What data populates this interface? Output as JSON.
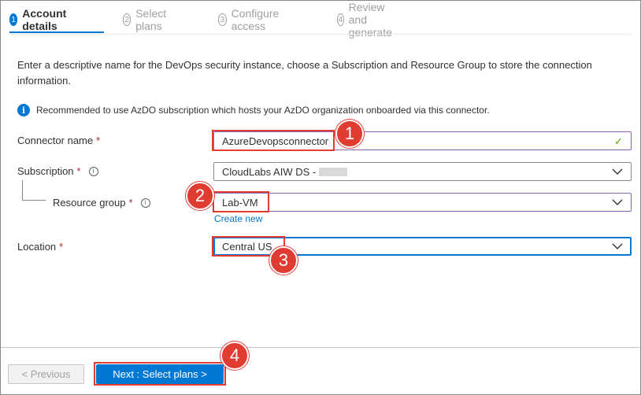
{
  "tabs": [
    {
      "num": "1",
      "label": "Account details",
      "active": true
    },
    {
      "num": "2",
      "label": "Select plans"
    },
    {
      "num": "3",
      "label": "Configure access"
    },
    {
      "num": "4",
      "label": "Review and generate"
    }
  ],
  "description": "Enter a descriptive name for the DevOps security instance, choose a Subscription and Resource Group to store the connection information.",
  "info": {
    "icon": "info-icon",
    "text": "Recommended to use AzDO subscription which hosts your AzDO organization onboarded via this connector."
  },
  "form": {
    "connector_name": {
      "label": "Connector name",
      "required": "*",
      "value": "AzureDevopsconnector"
    },
    "subscription": {
      "label": "Subscription",
      "required": "*",
      "value": "CloudLabs AIW DS -"
    },
    "resource_group": {
      "label": "Resource group",
      "required": "*",
      "value": "Lab-VM",
      "create_new": "Create new"
    },
    "location": {
      "label": "Location",
      "required": "*",
      "value": "Central US"
    }
  },
  "annotations": [
    "1",
    "2",
    "3",
    "4"
  ],
  "footer": {
    "previous": "< Previous",
    "next": "Next : Select plans >"
  },
  "colors": {
    "accent": "#0078d4",
    "highlight": "#e03c31",
    "required": "#a4262c",
    "valid": "#57a300"
  }
}
